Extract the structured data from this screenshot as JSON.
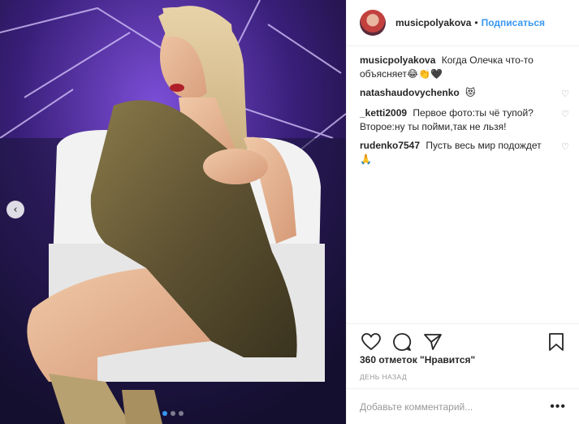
{
  "post": {
    "username": "musicpolyakova",
    "separator": "•",
    "follow_label": "Подписаться",
    "caption": {
      "author": "musicpolyakova",
      "text": "Когда Олечка что-то объясняет😂👏🖤"
    },
    "comments": [
      {
        "author": "natashaudovychenko",
        "text": "😻"
      },
      {
        "author": "_ketti2009",
        "text": "Первое фото:ты чё тупой? Второе:ну ты пойми,так не льзя!"
      },
      {
        "author": "rudenko7547",
        "text": "Пусть весь мир подождет 🙏"
      }
    ],
    "likes_text": "360 отметок \"Нравится\"",
    "time_ago": "день назад",
    "comment_placeholder": "Добавьте комментарий...",
    "more_label": "•••",
    "prev_arrow": "‹"
  },
  "icons": {
    "like": "heart-outline-icon",
    "comment": "speech-bubble-icon",
    "share": "paper-plane-icon",
    "save": "bookmark-icon"
  },
  "colors": {
    "accent": "#3897f0",
    "muted": "#999999",
    "text": "#262626"
  },
  "carousel": {
    "count": 3,
    "active": 0
  }
}
